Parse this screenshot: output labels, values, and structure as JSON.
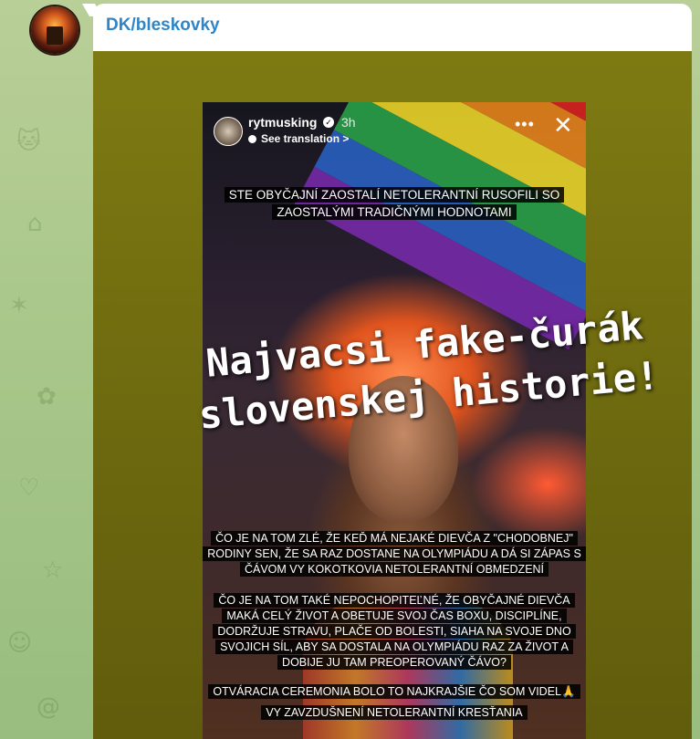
{
  "channel": {
    "name": "DK/bleskovky"
  },
  "story": {
    "username": "rytmusking",
    "time": "3h",
    "translate_label": "See translation >",
    "more_icon": "more-icon",
    "close_icon": "close-icon",
    "caption_top": "STE OBYČAJNÍ ZAOSTALÍ NETOLERANTNÍ RUSOFILI SO ZAOSTALÝMI TRADIČNÝMI HODNOTAMI",
    "caption_mid1": "ČO JE NA TOM ZLÉ, ŽE KEĎ MÁ NEJAKÉ DIEVČA Z \"CHODOBNEJ\" RODINY SEN, ŽE SA RAZ DOSTANE NA OLYMPIÁDU A DÁ SI ZÁPAS S ČÁVOM VY KOKOTKOVIA NETOLERANTNÍ OBMEDZENÍ",
    "caption_mid2": "ČO JE NA TOM TAKÉ NEPOCHOPITEĽNÉ, ŽE OBYČAJNÉ DIEVČA MAKÁ CELÝ ŽIVOT A OBETUJE SVOJ ČAS BOXU, DISCIPLÍNE, DODRŽUJE STRAVU, PLAČE OD BOLESTI, SIAHA NA SVOJE DNO SVOJICH SÍL, ABY SA DOSTALA NA OLYMPIÁDU RAZ ZA ŽIVOT A DOBIJE JU TAM PREOPEROVANÝ ČÁVO?",
    "caption_bottom1": "OTVÁRACIA CEREMONIA BOLO TO NAJKRAJŠIE ČO SOM VIDEL🙏",
    "caption_bottom2": "VY ZAVZDUŠNENÍ NETOLERANTNÍ KRESŤANIA"
  },
  "overlay": {
    "line1": "Najvacsi fake-čurák",
    "line2": "slovenskej historie!"
  }
}
